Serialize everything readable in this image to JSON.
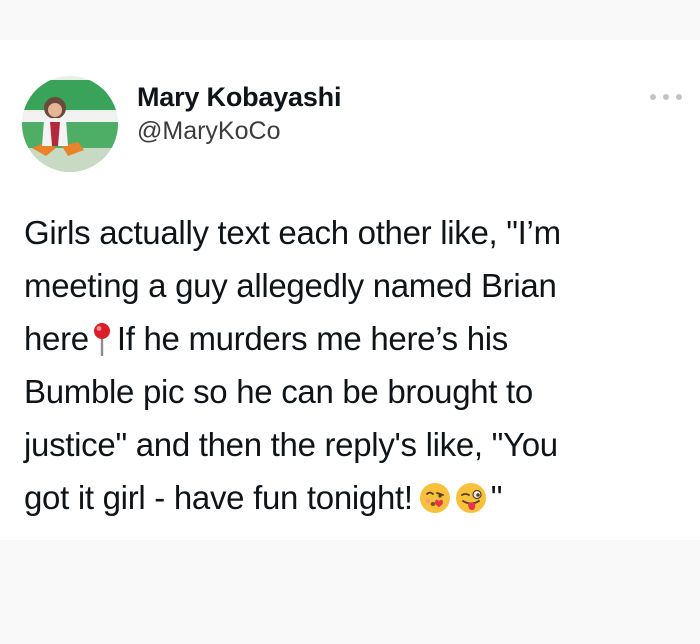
{
  "tweet": {
    "display_name": "Mary Kobayashi",
    "handle": "@MaryKoCo",
    "more_icon": "more-horizontal-icon",
    "text_segments": {
      "line1": "Girls actually text each other like, \"I’m",
      "line2": "meeting a guy allegedly named Brian",
      "line3a": "here",
      "line3b": "If he murders me here’s his",
      "line4": "Bumble pic so he can be brought to",
      "line5": "justice\" and then the reply's like, \"You",
      "line6a": "got it girl - have fun tonight!",
      "line6b": "\""
    },
    "emojis": [
      "round-pushpin-icon",
      "face-blowing-kiss-icon",
      "winking-face-with-tongue-icon"
    ]
  },
  "colors": {
    "text": "#0f1419",
    "handle": "#3c3c3c",
    "background": "#ffffff",
    "page_background": "#f9f9f9",
    "pin_red": "#d9202a",
    "emoji_yellow": "#f7c13b"
  }
}
